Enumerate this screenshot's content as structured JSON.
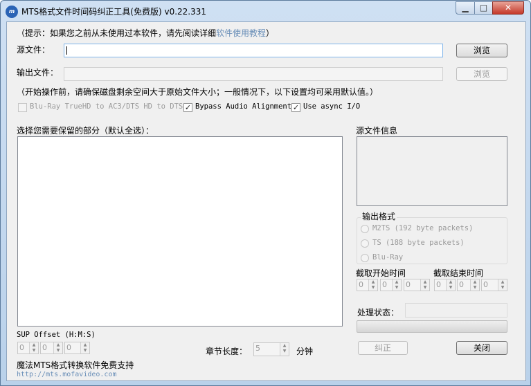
{
  "window": {
    "title": "MTS格式文件时间码纠正工具(免费版) v0.22.331",
    "icon_text": "m",
    "controls": {
      "minimize": "▁",
      "maximize": "□",
      "close": "✕"
    }
  },
  "hint": {
    "prefix": "（提示：如果您之前从未使用过本软件，请先阅读详细",
    "link": "软件使用教程",
    "suffix": "）"
  },
  "source": {
    "label": "源文件：",
    "value": "",
    "browse": "浏览"
  },
  "output": {
    "label": "输出文件：",
    "value": "",
    "browse": "浏览"
  },
  "notice": "（开始操作前，请确保磁盘剩余空间大于原始文件大小；一般情况下，以下设置均可采用默认值。）",
  "options": [
    {
      "label": "Blu-Ray TrueHD to AC3/DTS HD to DTS",
      "checked": false,
      "enabled": false
    },
    {
      "label": "Bypass Audio Alignment",
      "checked": true,
      "enabled": true
    },
    {
      "label": "Use async I/O",
      "checked": true,
      "enabled": true
    }
  ],
  "parts": {
    "label": "选择您需要保留的部分（默认全选）："
  },
  "source_info": {
    "label": "源文件信息"
  },
  "output_format": {
    "label": "输出格式",
    "options": [
      "M2TS (192 byte packets)",
      "TS (188 byte packets)",
      "Blu-Ray"
    ]
  },
  "start_time": {
    "label": "截取开始时间",
    "h": "0",
    "m": "0",
    "s": "0"
  },
  "end_time": {
    "label": "截取结束时间",
    "h": "0",
    "m": "0",
    "s": "0"
  },
  "status": {
    "label": "处理状态：",
    "value": "",
    "progress": 0
  },
  "sup_offset": {
    "label": "SUP Offset (H:M:S)",
    "h": "0",
    "m": "0",
    "s": "0"
  },
  "chapter": {
    "label": "章节长度：",
    "value": "5",
    "unit": "分钟"
  },
  "buttons": {
    "fix": "纠正",
    "close": "关闭"
  },
  "footer": {
    "support": "魔法MTS格式转换软件免费支持",
    "url": "http://mts.mofavideo.com"
  }
}
